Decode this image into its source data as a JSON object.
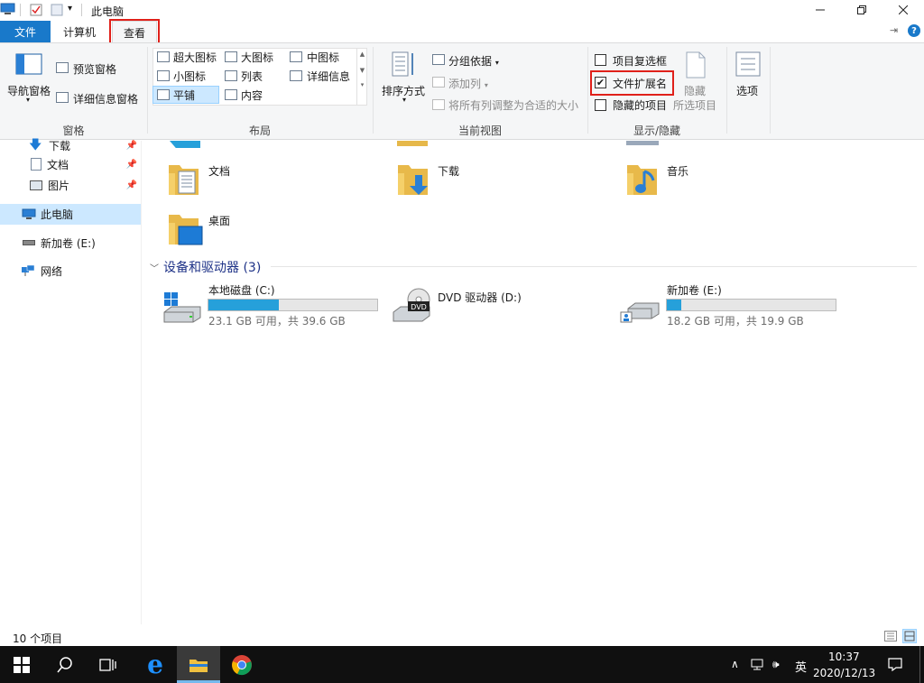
{
  "window": {
    "title": "此电脑"
  },
  "tabs": {
    "file": "文件",
    "computer": "计算机",
    "view": "查看"
  },
  "ribbon": {
    "panes": {
      "nav_pane": "导航窗格",
      "preview_pane": "预览窗格",
      "details_pane": "详细信息窗格",
      "group_label": "窗格"
    },
    "layout": {
      "items": [
        "超大图标",
        "大图标",
        "中图标",
        "小图标",
        "列表",
        "详细信息",
        "平铺",
        "内容"
      ],
      "selected": "平铺",
      "group_label": "布局"
    },
    "current_view": {
      "sort_by": "排序方式",
      "group_by": "分组依据",
      "add_columns": "添加列",
      "size_all_columns": "将所有列调整为合适的大小",
      "group_label": "当前视图"
    },
    "show_hide": {
      "item_check_boxes": {
        "label": "项目复选框",
        "checked": false
      },
      "file_extensions": {
        "label": "文件扩展名",
        "checked": true
      },
      "hidden_items": {
        "label": "隐藏的项目",
        "checked": false
      },
      "hide_selected_1": "隐藏",
      "hide_selected_2": "所选项目",
      "group_label": "显示/隐藏"
    },
    "options": "选项"
  },
  "nav": {
    "items": [
      {
        "label": "下载",
        "pinned": true
      },
      {
        "label": "文档",
        "pinned": true
      },
      {
        "label": "图片",
        "pinned": true
      },
      {
        "label": "此电脑",
        "selected": true
      },
      {
        "label": "新加卷 (E:)"
      },
      {
        "label": "网络"
      }
    ]
  },
  "folders": [
    "文档",
    "下载",
    "音乐",
    "桌面"
  ],
  "devices": {
    "header": "设备和驱动器 (3)",
    "drives": [
      {
        "name": "本地磁盘 (C:)",
        "free": "23.1 GB 可用，共 39.6 GB",
        "used_fraction": 0.417
      },
      {
        "name": "DVD 驱动器 (D:)"
      },
      {
        "name": "新加卷 (E:)",
        "free": "18.2 GB 可用，共 19.9 GB",
        "used_fraction": 0.085
      }
    ]
  },
  "status": {
    "item_count": "10 个项目"
  },
  "taskbar": {
    "ime": "英",
    "time": "10:37",
    "date": "2020/12/13"
  },
  "colors": {
    "accent": "#1979ca",
    "highlight": "#e0201a",
    "drive_fill": "#26a0da",
    "selected_bg": "#cce8ff"
  }
}
